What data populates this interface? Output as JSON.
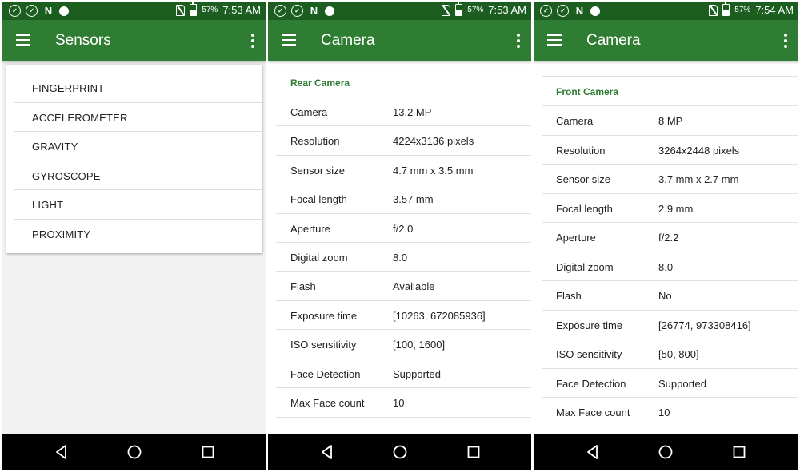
{
  "screens": [
    {
      "status": {
        "battery": "57%",
        "time": "7:53 AM"
      },
      "toolbar": {
        "title": "Sensors"
      },
      "sensors": [
        "FINGERPRINT",
        "ACCELEROMETER",
        "GRAVITY",
        "GYROSCOPE",
        "LIGHT",
        "PROXIMITY"
      ]
    },
    {
      "status": {
        "battery": "57%",
        "time": "7:53 AM"
      },
      "toolbar": {
        "title": "Camera"
      },
      "section": "Rear Camera",
      "rows": [
        {
          "label": "Camera",
          "value": "13.2 MP"
        },
        {
          "label": "Resolution",
          "value": "4224x3136 pixels"
        },
        {
          "label": "Sensor size",
          "value": "4.7 mm x 3.5 mm"
        },
        {
          "label": "Focal length",
          "value": "3.57 mm"
        },
        {
          "label": "Aperture",
          "value": "f/2.0"
        },
        {
          "label": "Digital zoom",
          "value": "8.0"
        },
        {
          "label": "Flash",
          "value": "Available"
        },
        {
          "label": "Exposure time",
          "value": "[10263, 672085936]"
        },
        {
          "label": "ISO sensitivity",
          "value": "[100, 1600]"
        },
        {
          "label": "Face Detection",
          "value": "Supported"
        },
        {
          "label": "Max Face count",
          "value": "10"
        }
      ]
    },
    {
      "status": {
        "battery": "57%",
        "time": "7:54 AM"
      },
      "toolbar": {
        "title": "Camera"
      },
      "section": "Front Camera",
      "rows": [
        {
          "label": "Camera",
          "value": "8 MP"
        },
        {
          "label": "Resolution",
          "value": "3264x2448 pixels"
        },
        {
          "label": "Sensor size",
          "value": "3.7 mm x 2.7 mm"
        },
        {
          "label": "Focal length",
          "value": "2.9 mm"
        },
        {
          "label": "Aperture",
          "value": "f/2.2"
        },
        {
          "label": "Digital zoom",
          "value": "8.0"
        },
        {
          "label": "Flash",
          "value": "No"
        },
        {
          "label": "Exposure time",
          "value": "[26774, 973308416]"
        },
        {
          "label": "ISO sensitivity",
          "value": "[50, 800]"
        },
        {
          "label": "Face Detection",
          "value": "Supported"
        },
        {
          "label": "Max Face count",
          "value": "10"
        }
      ]
    }
  ],
  "icons": {
    "status_left": [
      "check-circle-icon",
      "check-circle-icon",
      "n-notification-icon",
      "app-notification-icon"
    ],
    "status_right": [
      "no-sim-icon",
      "battery-charging-icon"
    ],
    "toolbar": [
      "hamburger-menu-icon",
      "overflow-menu-icon"
    ],
    "nav": [
      "back-icon",
      "home-icon",
      "recents-icon"
    ]
  },
  "colors": {
    "toolbar": "#2e7d32",
    "statusbar": "#1b5e20",
    "section_title": "#2e7d32",
    "navbar": "#000000"
  }
}
